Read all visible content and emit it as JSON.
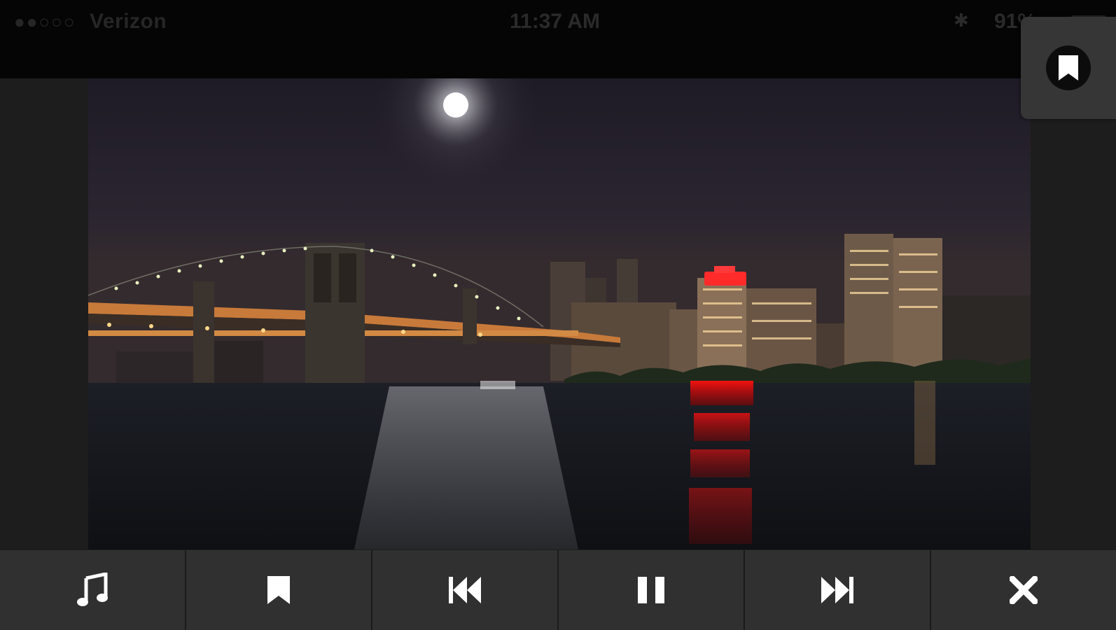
{
  "status_bar": {
    "signal": "●●○○○",
    "carrier": "Verizon",
    "time": "11:37 AM",
    "battery": "91%"
  },
  "colors": {
    "toolbar_bg": "#303030",
    "icon": "#ffffff",
    "status_bg": "#050505"
  },
  "floating_button": {
    "icon": "bookmark-icon"
  },
  "toolbar": {
    "buttons": [
      {
        "id": "music",
        "icon": "music-note-icon"
      },
      {
        "id": "bookmark",
        "icon": "bookmark-icon"
      },
      {
        "id": "previous",
        "icon": "skip-previous-icon"
      },
      {
        "id": "pause",
        "icon": "pause-icon"
      },
      {
        "id": "next",
        "icon": "skip-next-icon"
      },
      {
        "id": "close",
        "icon": "close-icon"
      }
    ]
  }
}
